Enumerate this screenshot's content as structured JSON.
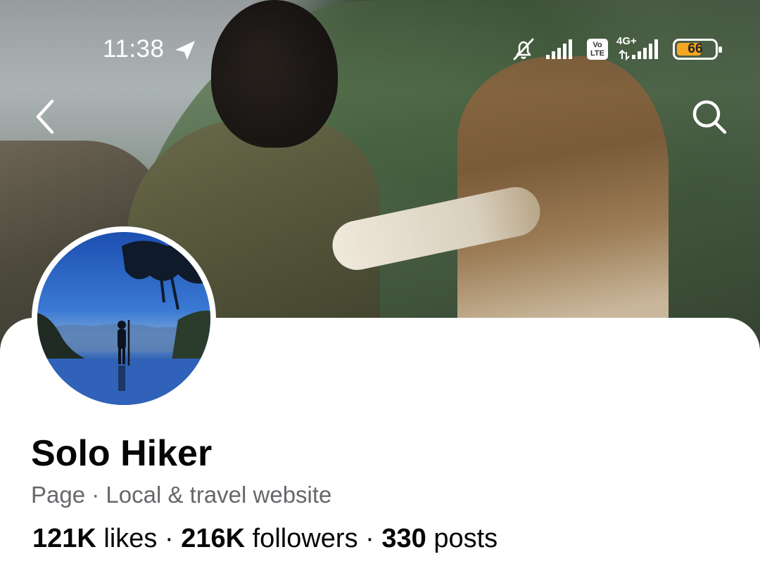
{
  "status_bar": {
    "time": "11:38",
    "network_type": "4G+",
    "volte_top": "Vo",
    "volte_bottom": "LTE",
    "battery_level": "66"
  },
  "icons": {
    "back": "chevron-left-icon",
    "search": "search-icon",
    "navigation": "navigation-arrow-icon",
    "mute": "bell-off-icon",
    "signal": "signal-bars-icon",
    "battery": "battery-icon"
  },
  "colors": {
    "battery_fill": "#f5a623",
    "meta_text": "#65676b",
    "primary_text": "#050505"
  },
  "profile": {
    "name": "Solo Hiker",
    "category_type": "Page",
    "separator": "·",
    "category": "Local & travel website",
    "likes_count": "121K",
    "likes_label": "likes",
    "followers_count": "216K",
    "followers_label": "followers",
    "posts_count": "330",
    "posts_label": "posts"
  }
}
